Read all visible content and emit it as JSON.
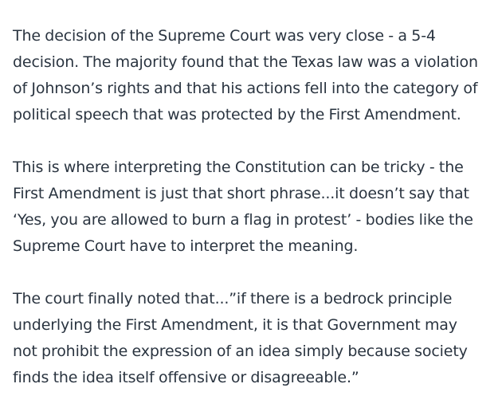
{
  "paragraphs": [
    {
      "lines": [
        "The decision of the Supreme Court was very close - a 5-4",
        "decision. The majority found that the Texas law was a violation",
        "of Johnson’s rights and that his actions fell into the category of",
        "political speech that was protected by the First Amendment."
      ]
    },
    {
      "lines": [
        "This is where interpreting the Constitution can be tricky - the",
        "First Amendment is just that short phrase...it doesn’t say that",
        "‘Yes, you are allowed to burn a flag in protest’ - bodies like the",
        "Supreme Court have to interpret the meaning."
      ]
    },
    {
      "lines": [
        "The court finally noted that...”if there is a bedrock principle",
        "underlying the First Amendment, it is that Government may",
        "not prohibit the expression of an idea simply because society",
        "finds the idea itself offensive or disagreeable.”"
      ]
    }
  ]
}
